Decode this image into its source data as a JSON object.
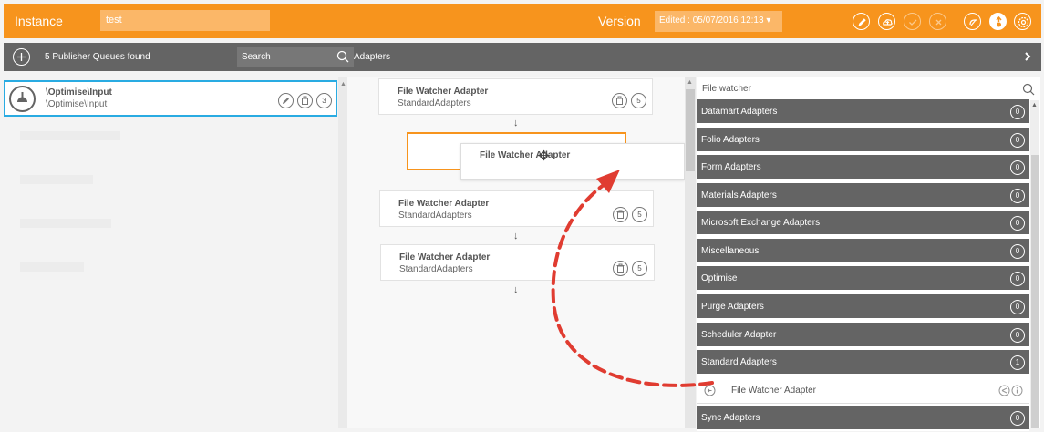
{
  "topbar": {
    "instance_label": "Instance",
    "instance_value": "test",
    "version_label": "Version",
    "version_value": "Edited : 05/07/2016 12:13 ▾",
    "icons": [
      "pencil-icon",
      "save-cloud-icon",
      "check-icon",
      "cancel-icon",
      "undo-icon",
      "deploy-icon",
      "settings-icon"
    ]
  },
  "subbar": {
    "count_text": "5 Publisher Queues found",
    "search_placeholder": "Search",
    "adapters_label": "Adapters"
  },
  "queue": {
    "name": "\\Optimise\\Input",
    "path": "\\Optimise\\Input",
    "count": "3"
  },
  "pipeline": {
    "cards": [
      {
        "name": "File Watcher Adapter",
        "sub": "StandardAdapters",
        "count": "5"
      },
      {
        "name": "File Watcher Adapter",
        "sub": "StandardAdapters",
        "count": "5"
      },
      {
        "name": "File Watcher Adapter",
        "sub": "StandardAdapters",
        "count": "5"
      }
    ],
    "dragging_label": "File Watcher Adapter"
  },
  "catalog": {
    "search_value": "File watcher",
    "groups": [
      {
        "name": "Datamart Adapters",
        "count": "0"
      },
      {
        "name": "Folio Adapters",
        "count": "0"
      },
      {
        "name": "Form Adapters",
        "count": "0"
      },
      {
        "name": "Materials Adapters",
        "count": "0"
      },
      {
        "name": "Microsoft Exchange Adapters",
        "count": "0"
      },
      {
        "name": "Miscellaneous",
        "count": "0"
      },
      {
        "name": "Optimise",
        "count": "0"
      },
      {
        "name": "Purge Adapters",
        "count": "0"
      },
      {
        "name": "Scheduler Adapter",
        "count": "0"
      },
      {
        "name": "Standard Adapters",
        "count": "1"
      },
      {
        "name": "Sync Adapters",
        "count": "0"
      }
    ],
    "expanded_item": "File Watcher Adapter"
  },
  "colors": {
    "accent": "#f7941d",
    "bar": "#646464",
    "selection": "#29abe2",
    "drag_arrow": "#e03c31"
  }
}
